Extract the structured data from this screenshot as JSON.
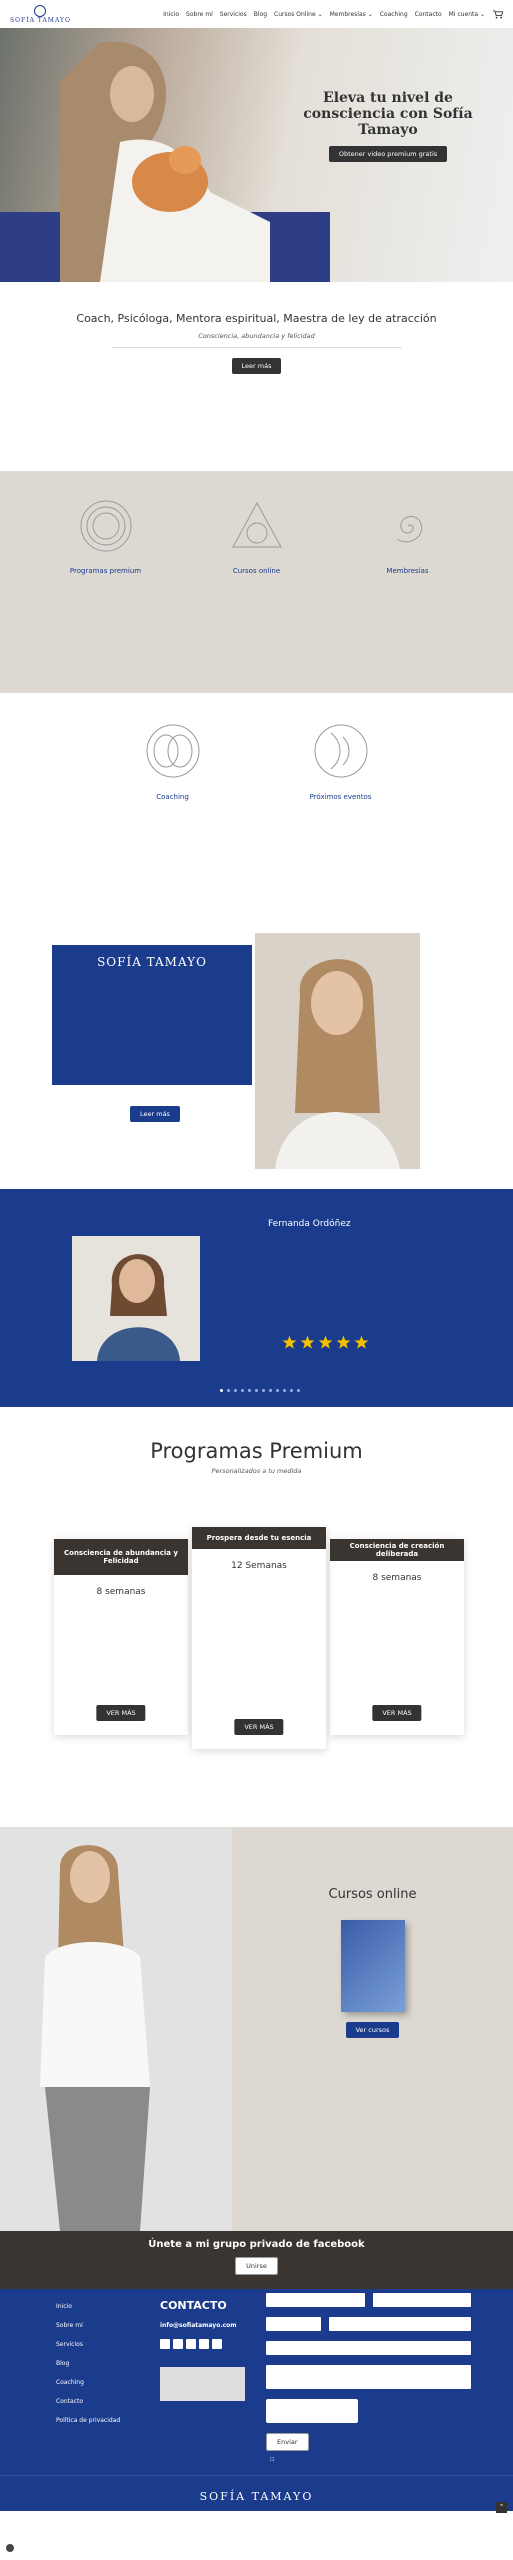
{
  "brand": {
    "logo_text": "SOFÍA TAMAYO",
    "color": "#1b3b8c"
  },
  "nav": {
    "items": [
      "Inicio",
      "Sobre mí",
      "Servicios",
      "Blog",
      "Cursos Online",
      "Membresías",
      "Coaching",
      "Contacto",
      "Mi cuenta"
    ],
    "icon": "cart-icon"
  },
  "hero": {
    "title": "Eleva tu nivel de consciencia con Sofía Tamayo",
    "subtitle": "",
    "button": "Obtener video premium gratis"
  },
  "intro": {
    "title": "Coach, Psicóloga, Mentora espiritual, Maestra de ley de atracción",
    "tagline": "Consciencia, abundancia y felicidad",
    "text": "",
    "button": "Leer más"
  },
  "services": [
    {
      "title": "Programas premium",
      "text": "",
      "icon": "concentric-circles-icon"
    },
    {
      "title": "Cursos online",
      "text": "",
      "icon": "triangle-circle-icon"
    },
    {
      "title": "Membresías",
      "text": "",
      "icon": "spiral-icon"
    }
  ],
  "services2": [
    {
      "title": "Coaching",
      "text": "",
      "icon": "vesica-circles-icon"
    },
    {
      "title": "Próximos eventos",
      "text": "",
      "icon": "curved-lines-icon"
    }
  ],
  "about": {
    "name": "SOFÍA TAMAYO",
    "quote": "",
    "button": "Leer más"
  },
  "testimonial": {
    "name": "Fernanda Ordóñez",
    "text": "",
    "stars": 5,
    "slides": 12,
    "active": 0
  },
  "programs": {
    "title": "Programas Premium",
    "tagline": "Personalizados a tu medida",
    "cards": [
      {
        "title": "Consciencia de abundancia y Felicidad",
        "weeks": "8 semanas",
        "items": [],
        "button": "VER MÁS"
      },
      {
        "title": "Prospera desde tu esencia",
        "weeks": "12 Semanas",
        "items": [],
        "button": "VER MÁS"
      },
      {
        "title": "Consciencia de creación deliberada",
        "weeks": "8 semanas",
        "items": [],
        "button": "VER MÁS"
      }
    ]
  },
  "cursos": {
    "title": "Cursos online",
    "tagline": "",
    "text": "",
    "button": "Ver cursos"
  },
  "facebook": {
    "title": "Únete a mi grupo privado de facebook",
    "button": "Unirse"
  },
  "footer": {
    "menu": [
      "Inicio",
      "Sobre mí",
      "Servicios",
      "Blog",
      "Coaching",
      "Contacto",
      "Política de privacidad"
    ],
    "contact_title": "CONTACTO",
    "email": "info@sofiatamayo.com",
    "form": {
      "name": "",
      "last_name": "",
      "country": "",
      "phone": "",
      "email": "",
      "message": "",
      "button": "Enviar",
      "privacy": ""
    }
  },
  "bottom": {
    "logo_text": "SOFÍA TAMAYO"
  }
}
